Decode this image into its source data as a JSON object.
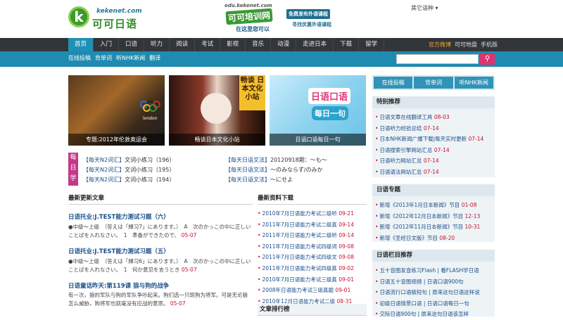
{
  "header": {
    "logo_letter": "k",
    "logo_domain": "kekenet.com",
    "logo_name": "可可日语",
    "edu_domain": "edu.kekenet.com",
    "edu_name": "可可培训网",
    "edu_slogan": "在这里您可以",
    "edu_tag1": "免费发布外语课程",
    "edu_tag2": "寻找优惠外语课程",
    "lang_menu": "其它语种 ▾"
  },
  "nav": {
    "items": [
      "首页",
      "入门",
      "口语",
      "听力",
      "阅读",
      "考试",
      "影视",
      "音乐",
      "动漫",
      "走进日本",
      "下载",
      "留学"
    ],
    "active_index": 0,
    "weibo": "官方微博",
    "site_map": "可可地盘",
    "mobile": "手机版"
  },
  "subbar": {
    "links": [
      "在线投稿",
      "背单词",
      "听NHK新闻",
      "翻译"
    ],
    "search_placeholder": "",
    "search_icon": "search-icon"
  },
  "promos": [
    {
      "caption": "专题:2012年伦敦奥运会",
      "extra": "london"
    },
    {
      "caption": "畅谈日本文化小站",
      "badge": "畅谈 日本文化小站"
    },
    {
      "caption": "日语口语每日一句",
      "title": "日语口语",
      "subtitle": "每日一句"
    }
  ],
  "daily": {
    "label": "每日学",
    "left": [
      {
        "tag": "【每天N2词汇】",
        "text": "文词小练习（196）"
      },
      {
        "tag": "【每天N2词汇】",
        "text": "文词小练习（195）"
      },
      {
        "tag": "【每天N2词汇】",
        "text": "文词小练习（194）"
      }
    ],
    "right": [
      {
        "tag": "【每天日语文法】",
        "text": "20120918期：～も～"
      },
      {
        "tag": "【每天日语文法】",
        "text": "～のみならず/のみか"
      },
      {
        "tag": "【每天日语文法】",
        "text": "～にせよ"
      }
    ]
  },
  "latest": {
    "heading": "最新更新文章",
    "articles": [
      {
        "title": "日语托业:J.TEST能力测试习题（六）",
        "body": "●中级～上级　（答えは「練习7」にあります。）　A　次のかっこの中に正しいことばを入れなさい。　1　準备ができたので、",
        "date": "05-07"
      },
      {
        "title": "日语托业:J.TEST能力测试习题（五）",
        "body": "●中级～上级　（答えは「練习6」にあります。）　A　次のかっこの中に正しいことばを入れなさい。　1　何か意见を言うとき",
        "date": "05-07"
      },
      {
        "title": "日语童话昨天:第119课 狼与狗的战争",
        "body": "有一次，狼的军队与狗的军队争吵起来。狗们选一只斑狗为将军。可是无论狼怎么威胁，狗将军也就毫没有应战的意思。",
        "date": "05-07"
      }
    ]
  },
  "resources": {
    "heading": "最新资料下载",
    "items": [
      {
        "text": "2010年7月日语能力考试二级听",
        "date": "09-21"
      },
      {
        "text": "2011年7月日语能力考试二级真",
        "date": "09-14"
      },
      {
        "text": "2011年7月日语能力考试二级听",
        "date": "09-14"
      },
      {
        "text": "2011年7月日语能力考试四级词",
        "date": "09-08"
      },
      {
        "text": "2011年7月日语能力考试四级文",
        "date": "09-08"
      },
      {
        "text": "2011年7月日语能力考试四级真",
        "date": "09-02"
      },
      {
        "text": "2010年7月日语能力考试三级真",
        "date": "09-01"
      },
      {
        "text": "2008年日语能力考试三级真题",
        "date": "09-01"
      },
      {
        "text": "2010年12月日语能力考试二级",
        "date": "08-31"
      }
    ],
    "ranking_heading": "文章排行榜"
  },
  "sidebar": {
    "tabs": [
      "在线投稿",
      "背单词",
      "听NHK新闻"
    ],
    "special": {
      "heading": "特别推荐",
      "items": [
        {
          "text": "日语文章在线翻译工具",
          "date": "08-03"
        },
        {
          "text": "日语听力经验总结",
          "date": "07-14"
        },
        {
          "text": "日本NHK新闻广播下载|每天实时更新",
          "date": "07-14"
        },
        {
          "text": "日语搜索引擎网站汇总",
          "date": "07-14"
        },
        {
          "text": "日语听力网站汇总",
          "date": "07-14"
        },
        {
          "text": "日语语法网站汇总",
          "date": "07-14"
        }
      ]
    },
    "topics": {
      "heading": "日语专题",
      "items": [
        {
          "text": "新增《2013年1月日本新闻》节目",
          "date": "01-08"
        },
        {
          "text": "新增《2012年12月日本新闻》节目",
          "date": "12-13"
        },
        {
          "text": "新增《2012年11月日本新闻》节目",
          "date": "10-31"
        },
        {
          "text": "新增《圣经日文版》节目",
          "date": "08-20"
        }
      ]
    },
    "columns": {
      "heading": "日语栏目推荐",
      "items": [
        "五十音图发音练习Flash | 看FLASH学日语",
        "日语五十音图视频 | 日语口语900句",
        "日语流行口语极短句 | 原来这句日语这样说",
        "初级日语情景口语 | 日语口语每日一句",
        "交际日语900句 | 原来这句日语该怎样"
      ]
    }
  },
  "colors": {
    "nav_bg": "#32363a",
    "nav_active": "#1f91b6",
    "subbar_bg": "#1f8bb0",
    "link": "#1a4f8b",
    "date": "#c8102e",
    "daily_label": "#c23a8a"
  }
}
